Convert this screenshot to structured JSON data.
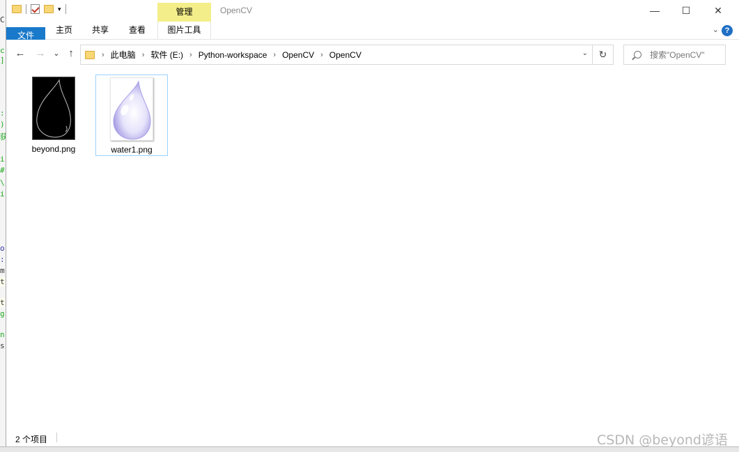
{
  "window": {
    "title": "OpenCV",
    "manage_tab": "管理",
    "controls": {
      "minimize": "—",
      "maximize": "☐",
      "close": "✕"
    }
  },
  "ribbon": {
    "tabs": [
      {
        "label": "文件"
      },
      {
        "label": "主页"
      },
      {
        "label": "共享"
      },
      {
        "label": "查看"
      },
      {
        "label": "图片工具"
      }
    ],
    "help": "?"
  },
  "nav": {
    "back": "←",
    "forward": "→",
    "recent": "⌄",
    "up": "↑",
    "breadcrumbs": [
      "此电脑",
      "软件 (E:)",
      "Python-workspace",
      "OpenCV",
      "OpenCV"
    ],
    "refresh": "↻",
    "search_placeholder": "搜索\"OpenCV\""
  },
  "files": [
    {
      "name": "beyond.png",
      "thumbnail": "black-drop-outline",
      "selected": false
    },
    {
      "name": "water1.png",
      "thumbnail": "purple-water-drop",
      "selected": true
    }
  ],
  "status": {
    "item_count": "2 个项目"
  },
  "watermark": "CSDN @beyond谚语"
}
